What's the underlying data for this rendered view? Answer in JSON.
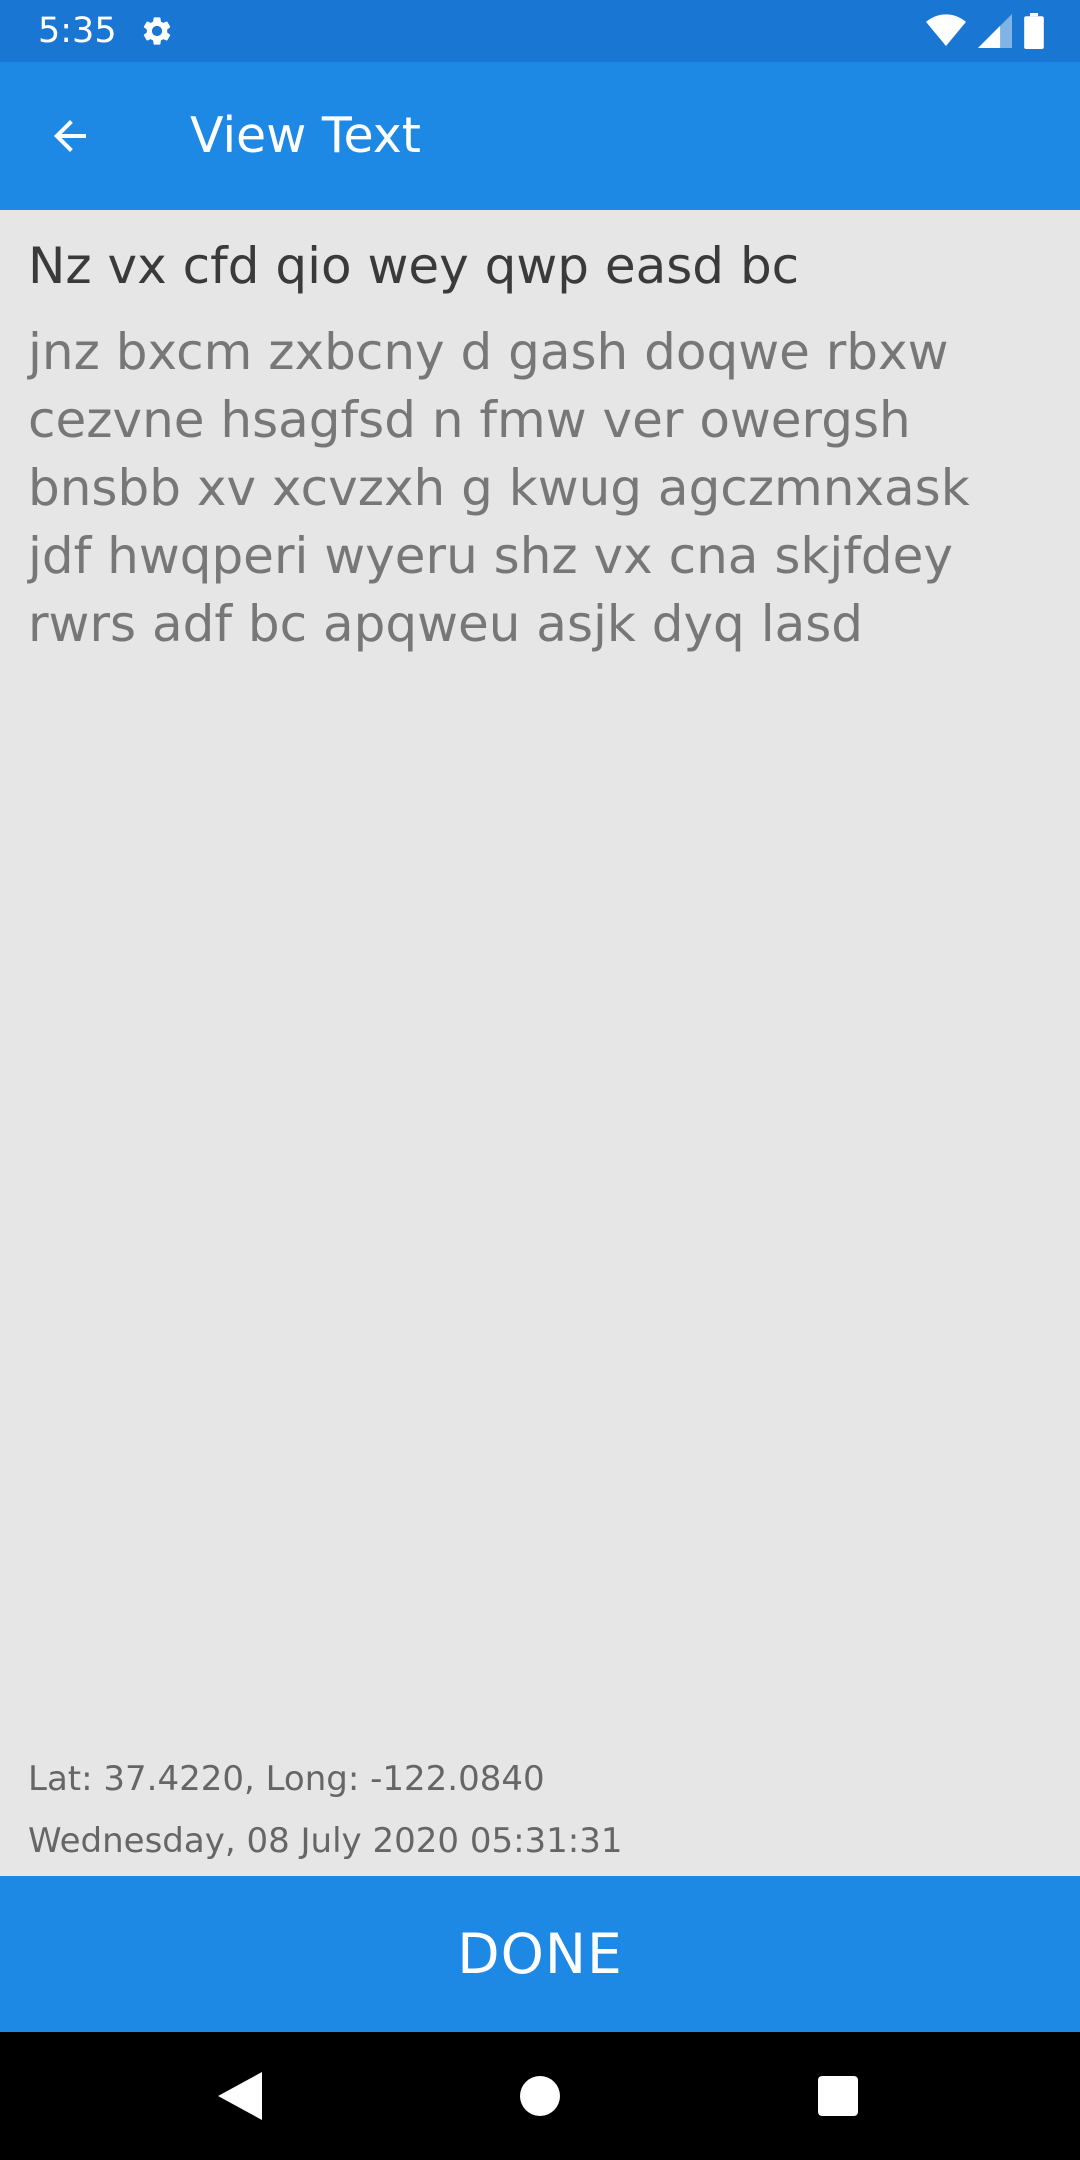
{
  "status_bar": {
    "time": "5:35",
    "icons": [
      "gear-icon",
      "wifi-icon",
      "cellular-signal-icon",
      "battery-icon"
    ],
    "background": "#1976d2"
  },
  "app_bar": {
    "title": "View Text",
    "back_icon": "arrow-back-icon",
    "background": "#1e88e5"
  },
  "note": {
    "title": "Nz vx cfd qio wey qwp easd bc",
    "body": "jnz bxcm zxbcny d gash doqwe rbxw\ncezvne hsagfsd n fmw ver owergsh\nbnsbb xv xcvzxh g kwug agczmnxask\njdf hwqperi wyeru shz vx cna skjfdey\nrwrs adf bc apqweu asjk dyq lasd",
    "location": "Lat: 37.4220, Long: -122.0840",
    "date": "Wednesday, 08 July 2020 05:31:31"
  },
  "done_button": {
    "label": "DONE",
    "background": "#1e88e5"
  },
  "nav_bar": {
    "icons": [
      "nav-back-icon",
      "nav-home-icon",
      "nav-recents-icon"
    ]
  }
}
